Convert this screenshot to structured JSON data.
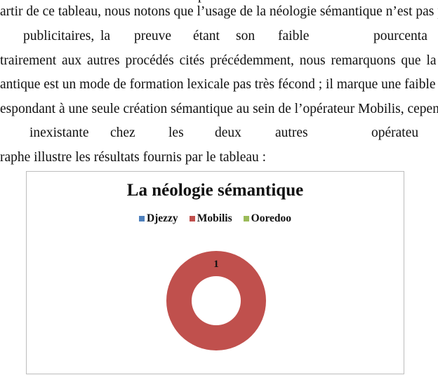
{
  "document": {
    "top_fragment": "p",
    "lines": [
      "artir de ce tableau, nous notons que l’usage de la néologie sémantique n’est pas prisé",
      "trairement aux autres procédés cités précédemment, nous remarquons que la créat",
      "antique est un mode de formation lexicale pas très fécond ; il marque une faible présen",
      "espondant à une seule création sémantique au sein de l’opérateur Mobilis, cependant, e",
      "raphe illustre les résultats fournis par le tableau :"
    ],
    "justified_line_1": [
      "publicitaires,",
      "la",
      "preuve",
      "étant",
      "son",
      "faible",
      "pourcenta"
    ],
    "justified_line_2": [
      "inexistante",
      "chez",
      "les",
      "deux",
      "autres",
      "opérateu"
    ]
  },
  "chart_data": {
    "type": "pie",
    "variant": "doughnut",
    "title": "La néologie sémantique",
    "categories": [
      "Djezzy",
      "Mobilis",
      "Ooredoo"
    ],
    "values": [
      0,
      1,
      0
    ],
    "colors": [
      "#4f81bd",
      "#c0504d",
      "#9bbb59"
    ],
    "data_labels": [
      "",
      "1",
      ""
    ],
    "legend_position": "top"
  }
}
